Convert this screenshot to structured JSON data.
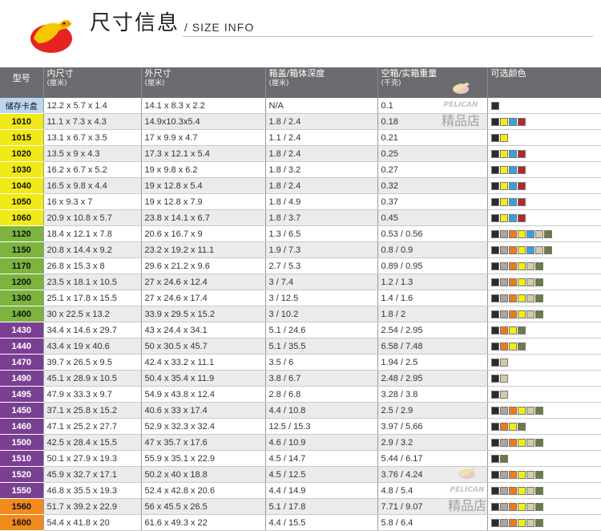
{
  "header": {
    "title": "尺寸信息",
    "subtitle": "/ SIZE INFO"
  },
  "watermark": {
    "en": "PELICAN",
    "cn": "精品店"
  },
  "table": {
    "columns": [
      {
        "label": "型号",
        "sub": ""
      },
      {
        "label": "内尺寸",
        "sub": "(厘米)"
      },
      {
        "label": "外尺寸",
        "sub": "(厘米)"
      },
      {
        "label": "箱盖/箱体深度",
        "sub": "(厘米)"
      },
      {
        "label": "空箱/实箱重量",
        "sub": "(千克)"
      },
      {
        "label": "可选颜色",
        "sub": ""
      }
    ],
    "color_map": {
      "K": "#2b2b2b",
      "G": "#a6a6a6",
      "Y": "#f7ec12",
      "B": "#3aa0dc",
      "R": "#b3292b",
      "O": "#ef7a1a",
      "T": "#d6c9a7",
      "D": "#6e7a45"
    },
    "rows": [
      {
        "model": "储存卡盒",
        "group": "blue",
        "inner": "12.2 x 5.7 x 1.4",
        "outer": "14.1 x 8.3 x 2.2",
        "depth": "N/A",
        "weight": "0.1",
        "colors": "K"
      },
      {
        "model": "1010",
        "group": "yellow",
        "inner": "11.1 x 7.3 x 4.3",
        "outer": "14.9x10.3x5.4",
        "depth": "1.8 / 2.4",
        "weight": "0.18",
        "colors": "KYBR"
      },
      {
        "model": "1015",
        "group": "yellow",
        "inner": "13.1 x 6.7 x 3.5",
        "outer": "17 x 9.9 x 4.7",
        "depth": "1.1 / 2.4",
        "weight": "0.21",
        "colors": "KY"
      },
      {
        "model": "1020",
        "group": "yellow",
        "inner": "13.5 x 9 x 4.3",
        "outer": "17.3 x 12.1 x 5.4",
        "depth": "1.8 / 2.4",
        "weight": "0.25",
        "colors": "KYBR"
      },
      {
        "model": "1030",
        "group": "yellow",
        "inner": "16.2 x 6.7 x 5.2",
        "outer": "19 x 9.8 x 6.2",
        "depth": "1.8 / 3.2",
        "weight": "0.27",
        "colors": "KYBR"
      },
      {
        "model": "1040",
        "group": "yellow",
        "inner": "16.5 x 9.8 x 4.4",
        "outer": "19 x 12.8 x 5.4",
        "depth": "1.8 / 2.4",
        "weight": "0.32",
        "colors": "KYBR"
      },
      {
        "model": "1050",
        "group": "yellow",
        "inner": "16 x 9.3 x 7",
        "outer": "19 x 12.8 x 7.9",
        "depth": "1.8 / 4.9",
        "weight": "0.37",
        "colors": "KYBR"
      },
      {
        "model": "1060",
        "group": "yellow",
        "inner": "20.9 x 10.8 x 5.7",
        "outer": "23.8 x 14.1 x 6.7",
        "depth": "1.8 / 3.7",
        "weight": "0.45",
        "colors": "KYBR"
      },
      {
        "model": "1120",
        "group": "green",
        "inner": "18.4 x 12.1 x 7.8",
        "outer": "20.6 x 16.7 x 9",
        "depth": "1.3 / 6.5",
        "weight": "0.53 / 0.56",
        "colors": "KGOYBTD"
      },
      {
        "model": "1150",
        "group": "green",
        "inner": "20.8 x 14.4 x 9.2",
        "outer": "23.2 x 19.2 x 11.1",
        "depth": "1.9 / 7.3",
        "weight": "0.8 / 0.9",
        "colors": "KGOYBTD"
      },
      {
        "model": "1170",
        "group": "green",
        "inner": "26.8 x 15.3 x 8",
        "outer": "29.6 x 21.2 x 9.6",
        "depth": "2.7 / 5.3",
        "weight": "0.89 / 0.95",
        "colors": "KGOYTD"
      },
      {
        "model": "1200",
        "group": "green",
        "inner": "23.5 x 18.1 x 10.5",
        "outer": "27 x 24.6 x 12.4",
        "depth": "3 / 7.4",
        "weight": "1.2 / 1.3",
        "colors": "KGOYTD"
      },
      {
        "model": "1300",
        "group": "green",
        "inner": "25.1 x 17.8 x 15.5",
        "outer": "27 x 24.6 x 17.4",
        "depth": "3 / 12.5",
        "weight": "1.4 / 1.6",
        "colors": "KGOYTD"
      },
      {
        "model": "1400",
        "group": "green",
        "inner": "30 x 22.5 x 13.2",
        "outer": "33.9 x 29.5 x 15.2",
        "depth": "3 / 10.2",
        "weight": "1.8 / 2",
        "colors": "KGOYTD"
      },
      {
        "model": "1430",
        "group": "purple",
        "inner": "34.4 x 14.6 x 29.7",
        "outer": "43 x 24.4 x 34.1",
        "depth": "5.1 / 24.6",
        "weight": "2.54 / 2.95",
        "colors": "KOYD"
      },
      {
        "model": "1440",
        "group": "purple",
        "inner": "43.4 x 19 x 40.6",
        "outer": "50 x 30.5 x 45.7",
        "depth": "5.1 / 35.5",
        "weight": "6.58 / 7.48",
        "colors": "KOYD"
      },
      {
        "model": "1470",
        "group": "purple",
        "inner": "39.7 x 26.5 x 9.5",
        "outer": "42.4 x 33.2 x 11.1",
        "depth": "3.5 / 6",
        "weight": "1.94 / 2.5",
        "colors": "KT"
      },
      {
        "model": "1490",
        "group": "purple",
        "inner": "45.1 x 28.9 x 10.5",
        "outer": "50.4 x 35.4 x 11.9",
        "depth": "3.8 / 6.7",
        "weight": "2.48 / 2.95",
        "colors": "KT"
      },
      {
        "model": "1495",
        "group": "purple",
        "inner": "47.9 x 33.3 x 9.7",
        "outer": "54.9 x 43.8 x 12.4",
        "depth": "2.8 / 6.8",
        "weight": "3.28 / 3.8",
        "colors": "KT"
      },
      {
        "model": "1450",
        "group": "purple",
        "inner": "37.1 x 25.8 x 15.2",
        "outer": "40.6 x 33 x 17.4",
        "depth": "4.4 / 10.8",
        "weight": "2.5 / 2.9",
        "colors": "KGOYTD"
      },
      {
        "model": "1460",
        "group": "purple",
        "inner": "47.1 x 25.2 x 27.7",
        "outer": "52.9 x 32.3 x 32.4",
        "depth": "12.5 / 15.3",
        "weight": "3.97 / 5.66",
        "colors": "KOYD"
      },
      {
        "model": "1500",
        "group": "purple",
        "inner": "42.5 x 28.4 x 15.5",
        "outer": "47 x 35.7 x 17.6",
        "depth": "4.6 / 10.9",
        "weight": "2.9 / 3.2",
        "colors": "KGOYTD"
      },
      {
        "model": "1510",
        "group": "purple",
        "inner": "50.1 x 27.9 x 19.3",
        "outer": "55.9 x 35.1 x 22.9",
        "depth": "4.5 / 14.7",
        "weight": "5.44 / 6.17",
        "colors": "KD"
      },
      {
        "model": "1520",
        "group": "purple",
        "inner": "45.9 x 32.7 x 17.1",
        "outer": "50.2 x 40 x 18.8",
        "depth": "4.5 / 12.5",
        "weight": "3.76 / 4.24",
        "colors": "KGOYTD"
      },
      {
        "model": "1550",
        "group": "purple",
        "inner": "46.8 x 35.5 x 19.3",
        "outer": "52.4 x 42.8 x 20.6",
        "depth": "4.4 / 14.9",
        "weight": "4.8 / 5.4",
        "colors": "KGOYTD"
      },
      {
        "model": "1560",
        "group": "orange",
        "inner": "51.7 x 39.2 x 22.9",
        "outer": "56 x 45.5 x 26.5",
        "depth": "5.1 / 17.8",
        "weight": "7.71 / 9.07",
        "colors": "KGOYTD"
      },
      {
        "model": "1600",
        "group": "orange",
        "inner": "54.4 x 41.8 x 20",
        "outer": "61.6 x 49.3 x 22",
        "depth": "4.4 / 15.5",
        "weight": "5.8 / 6.4",
        "colors": "KGOYTD"
      }
    ]
  }
}
